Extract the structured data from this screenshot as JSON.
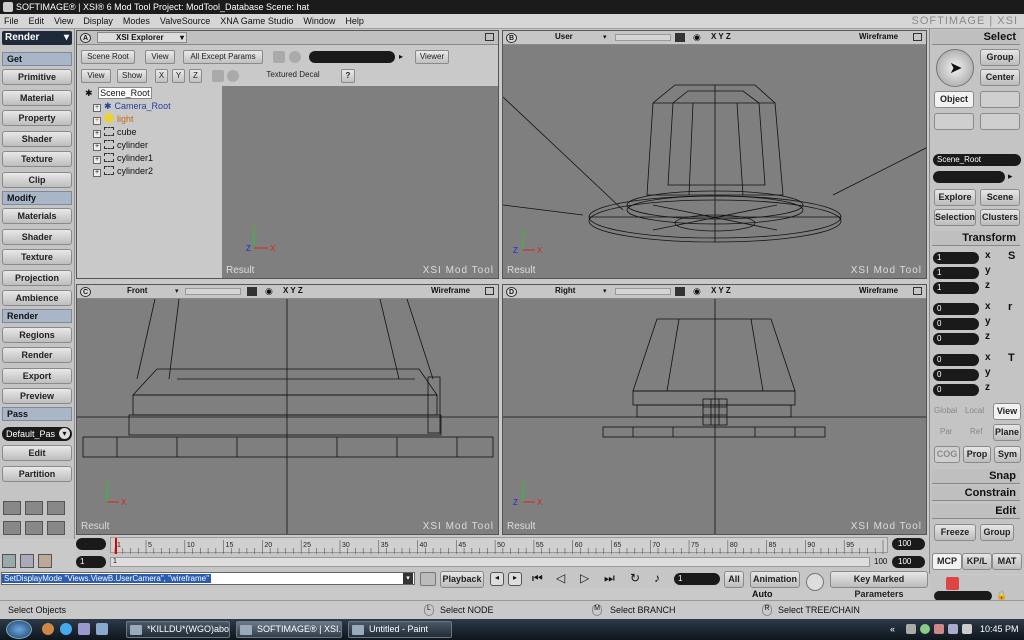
{
  "window": {
    "title": "SOFTIMAGE® | XSI® 6 Mod Tool Project: ModTool_Database     Scene: hat",
    "brand": "SOFTIMAGE | XSI"
  },
  "menu": [
    "File",
    "Edit",
    "View",
    "Display",
    "Modes",
    "ValveSource",
    "XNA Game Studio",
    "Window",
    "Help"
  ],
  "left_panel": {
    "mode": "Render",
    "sections": [
      {
        "header": "Get",
        "buttons": [
          "Primitive",
          "Material",
          "Property",
          "Shader",
          "Texture",
          "Clip"
        ]
      },
      {
        "header": "Modify",
        "buttons": [
          "Materials",
          "Shader",
          "Texture",
          "Projection",
          "Ambience"
        ]
      },
      {
        "header": "Render",
        "buttons": [
          "Regions",
          "Render",
          "Export",
          "Preview"
        ]
      },
      {
        "header": "Pass",
        "buttons": [
          "Edit",
          "Partition"
        ]
      }
    ],
    "pass_value": "Default_Pas"
  },
  "explorer": {
    "letter": "A",
    "title": "XSI Explorer",
    "toolbar1": [
      "Scene Root",
      "View",
      "All Except Params",
      "Viewer"
    ],
    "toolbar2": [
      "View",
      "Show",
      "X",
      "Y",
      "Z",
      "Textured Decal",
      "?"
    ],
    "tree": [
      {
        "label": "Scene_Root",
        "color": "#000"
      },
      {
        "label": "Camera_Root",
        "color": "#2a3e9a"
      },
      {
        "label": "light",
        "color": "#c76a1a"
      },
      {
        "label": "cube",
        "color": "#000"
      },
      {
        "label": "cylinder",
        "color": "#000"
      },
      {
        "label": "cylinder1",
        "color": "#000"
      },
      {
        "label": "cylinder2",
        "color": "#000"
      }
    ],
    "result": "Result",
    "watermark": "XSI Mod Tool"
  },
  "viewports": [
    {
      "letter": "B",
      "camera": "User",
      "mode": "Wireframe",
      "axes": "X Y Z",
      "result": "Result",
      "watermark": "XSI Mod Tool"
    },
    {
      "letter": "C",
      "camera": "Front",
      "mode": "Wireframe",
      "axes": "X Y Z",
      "result": "Result",
      "watermark": "XSI Mod Tool"
    },
    {
      "letter": "D",
      "camera": "Right",
      "mode": "Wireframe",
      "axes": "X Y Z",
      "result": "Result",
      "watermark": "XSI Mod Tool"
    }
  ],
  "right_panel": {
    "select": "Select",
    "group": "Group",
    "center": "Center",
    "object": "Object",
    "name_field": "Scene_Root",
    "explore": "Explore",
    "scene": "Scene",
    "selection": "Selection",
    "clusters": "Clusters",
    "transform": "Transform",
    "scale": [
      "1",
      "1",
      "1"
    ],
    "rotate": [
      "0",
      "0",
      "0"
    ],
    "translate": [
      "0",
      "0",
      "0"
    ],
    "axis_labels": [
      "x",
      "y",
      "z"
    ],
    "srt_labels": [
      "S",
      "r",
      "T"
    ],
    "ref_row1": [
      "Global",
      "Local",
      "View"
    ],
    "ref_row2": [
      "Par",
      "Ref",
      "Plane"
    ],
    "cog_row": [
      "COG",
      "Prop",
      "Sym"
    ],
    "snap": "Snap",
    "constrain": "Constrain",
    "edit": "Edit",
    "freeze": "Freeze",
    "group2": "Group",
    "tabs": [
      "MCP",
      "KP/L",
      "MAT"
    ]
  },
  "timeline": {
    "start": "1",
    "end_top": "100",
    "end_bottom": "100",
    "start_bottom": "1",
    "ticks": [
      "1",
      "5",
      "10",
      "15",
      "20",
      "25",
      "30",
      "35",
      "40",
      "45",
      "50",
      "55",
      "60",
      "65",
      "70",
      "75",
      "80",
      "85",
      "90",
      "95"
    ]
  },
  "command_bar": {
    "script": "SetDisplayMode \"Views.ViewB.UserCamera\", \"wireframe\"",
    "playback": "Playback",
    "frame": "1",
    "all": "All",
    "animation": "Animation",
    "auto": "Auto",
    "key_marked": "Key Marked Parameters"
  },
  "status": {
    "left": "Select Objects",
    "l": "Select NODE",
    "m": "Select BRANCH",
    "r": "Select TREE/CHAIN",
    "lk": "L",
    "mk": "M",
    "rk": "R"
  },
  "taskbar": {
    "tasks": [
      "*KILLDU*(WGO)abo...",
      "SOFTIMAGE® | XSI...",
      "Untitled - Paint"
    ],
    "clock": "10:45 PM"
  }
}
